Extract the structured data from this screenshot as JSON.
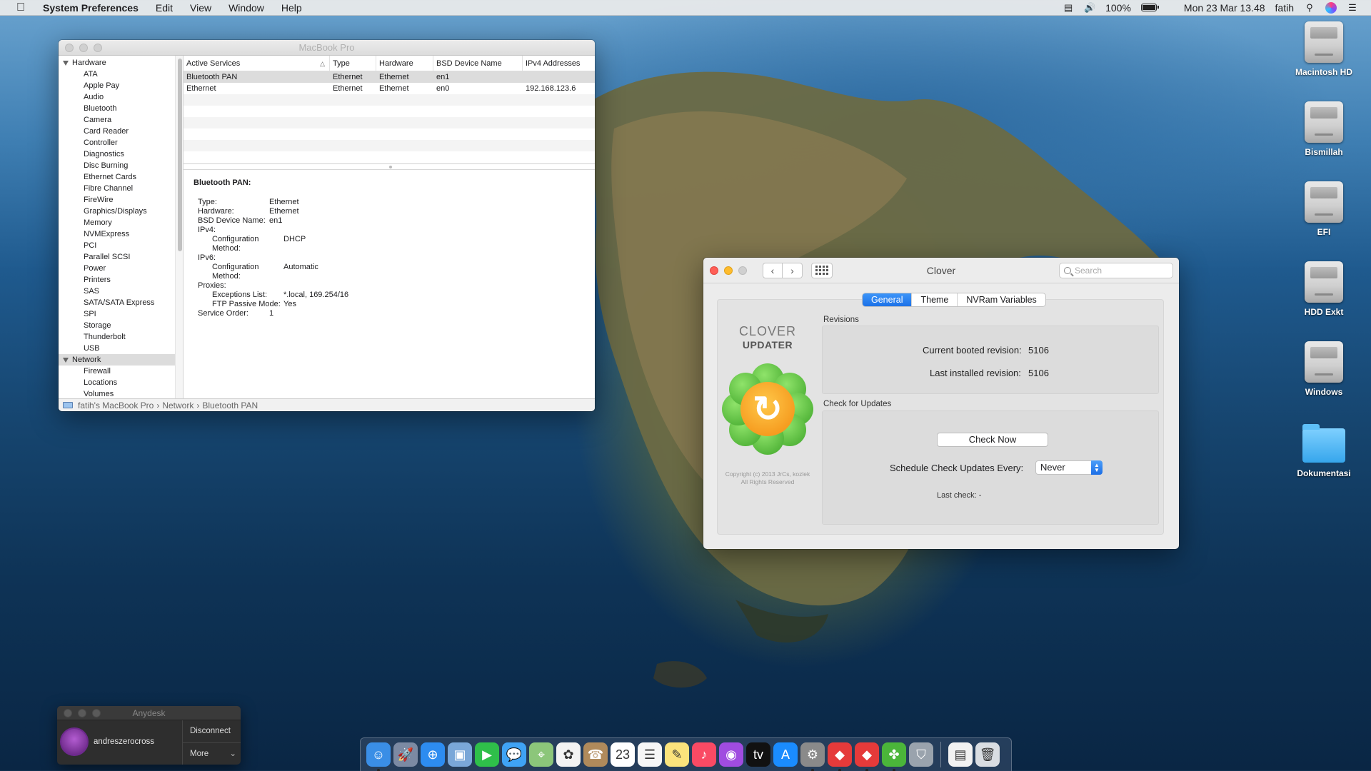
{
  "menubar": {
    "app_name": "System Preferences",
    "items": [
      "Edit",
      "View",
      "Window",
      "Help"
    ],
    "battery_percent": "100%",
    "datetime": "Mon 23 Mar  13.48",
    "user": "fatih"
  },
  "desktop_icons": [
    {
      "label": "Macintosh HD",
      "icon": "hdd"
    },
    {
      "label": "Bismillah",
      "icon": "hdd"
    },
    {
      "label": "EFI",
      "icon": "hdd"
    },
    {
      "label": "HDD Exkt",
      "icon": "hdd"
    },
    {
      "label": "Windows",
      "icon": "hdd"
    },
    {
      "label": "Dokumentasi",
      "icon": "folder"
    }
  ],
  "sysinfo": {
    "title": "MacBook Pro",
    "sidebar": {
      "hardware_label": "Hardware",
      "hardware_items": [
        "ATA",
        "Apple Pay",
        "Audio",
        "Bluetooth",
        "Camera",
        "Card Reader",
        "Controller",
        "Diagnostics",
        "Disc Burning",
        "Ethernet Cards",
        "Fibre Channel",
        "FireWire",
        "Graphics/Displays",
        "Memory",
        "NVMExpress",
        "PCI",
        "Parallel SCSI",
        "Power",
        "Printers",
        "SAS",
        "SATA/SATA Express",
        "SPI",
        "Storage",
        "Thunderbolt",
        "USB"
      ],
      "network_label": "Network",
      "network_items": [
        "Firewall",
        "Locations",
        "Volumes"
      ]
    },
    "table": {
      "headers": [
        "Active Services",
        "Type",
        "Hardware",
        "BSD Device Name",
        "IPv4 Addresses"
      ],
      "rows": [
        [
          "Bluetooth PAN",
          "Ethernet",
          "Ethernet",
          "en1",
          ""
        ],
        [
          "Ethernet",
          "Ethernet",
          "Ethernet",
          "en0",
          "192.168.123.6"
        ]
      ]
    },
    "details": {
      "heading": "Bluetooth PAN:",
      "lines": [
        {
          "k": "Type:",
          "v": "Ethernet",
          "sub": false
        },
        {
          "k": "Hardware:",
          "v": "Ethernet",
          "sub": false
        },
        {
          "k": "BSD Device Name:",
          "v": "en1",
          "sub": false
        },
        {
          "k": "IPv4:",
          "v": "",
          "sub": false
        },
        {
          "k": "Configuration Method:",
          "v": "DHCP",
          "sub": true
        },
        {
          "k": "IPv6:",
          "v": "",
          "sub": false
        },
        {
          "k": "Configuration Method:",
          "v": "Automatic",
          "sub": true
        },
        {
          "k": "Proxies:",
          "v": "",
          "sub": false
        },
        {
          "k": "Exceptions List:",
          "v": "*.local, 169.254/16",
          "sub": true
        },
        {
          "k": "FTP Passive Mode:",
          "v": "Yes",
          "sub": true
        },
        {
          "k": "Service Order:",
          "v": "1",
          "sub": false
        }
      ]
    },
    "path": [
      "fatih's MacBook Pro",
      "Network",
      "Bluetooth PAN"
    ]
  },
  "clover": {
    "title": "Clover",
    "search_placeholder": "Search",
    "tabs": [
      "General",
      "Theme",
      "NVRam Variables"
    ],
    "active_tab": "General",
    "logo_line1": "CLOVER",
    "logo_line2": "UPDATER",
    "copyright_line1": "Copyright (c) 2013 JrCs, kozlek",
    "copyright_line2": "All Rights Reserved",
    "revisions_label": "Revisions",
    "current_label": "Current booted revision:",
    "current_value": "5106",
    "installed_label": "Last installed revision:",
    "installed_value": "5106",
    "check_label": "Check for Updates",
    "check_now": "Check Now",
    "schedule_label": "Schedule Check Updates Every:",
    "schedule_value": "Never",
    "last_check": "Last check: -"
  },
  "anydesk": {
    "title": "Anydesk",
    "user": "andreszerocross",
    "disconnect": "Disconnect",
    "more": "More"
  },
  "dock": {
    "apps": [
      {
        "name": "finder-icon",
        "color": "#3a8ee6",
        "glyph": "☺"
      },
      {
        "name": "launchpad-icon",
        "color": "#7c8aa3",
        "glyph": "🚀"
      },
      {
        "name": "safari-icon",
        "color": "#2d8cf0",
        "glyph": "⊕"
      },
      {
        "name": "preview-icon",
        "color": "#7aa7d8",
        "glyph": "▣"
      },
      {
        "name": "facetime-icon",
        "color": "#2fbf4a",
        "glyph": "▶"
      },
      {
        "name": "messages-icon",
        "color": "#3fa3f5",
        "glyph": "💬"
      },
      {
        "name": "maps-icon",
        "color": "#8cc67a",
        "glyph": "⌖"
      },
      {
        "name": "photos-icon",
        "color": "#f3f3f3",
        "glyph": "✿"
      },
      {
        "name": "contacts-icon",
        "color": "#b08a5b",
        "glyph": "☎"
      },
      {
        "name": "calendar-icon",
        "color": "#ffffff",
        "glyph": "23"
      },
      {
        "name": "reminders-icon",
        "color": "#f6f6f6",
        "glyph": "☰"
      },
      {
        "name": "notes-icon",
        "color": "#fbe37c",
        "glyph": "✎"
      },
      {
        "name": "music-icon",
        "color": "#fa4a64",
        "glyph": "♪"
      },
      {
        "name": "podcasts-icon",
        "color": "#a04ce0",
        "glyph": "◉"
      },
      {
        "name": "tv-icon",
        "color": "#111111",
        "glyph": "tv"
      },
      {
        "name": "appstore-icon",
        "color": "#1a8cff",
        "glyph": "A"
      },
      {
        "name": "system-preferences-icon",
        "color": "#8a8a8a",
        "glyph": "⚙"
      },
      {
        "name": "anydesk-icon",
        "color": "#e53a3a",
        "glyph": "◆"
      },
      {
        "name": "anydesk-alt-icon",
        "color": "#e53a3a",
        "glyph": "◆"
      },
      {
        "name": "clover-icon",
        "color": "#4bb53a",
        "glyph": "✤"
      },
      {
        "name": "disk-utility-icon",
        "color": "#9aa3ad",
        "glyph": "⛉"
      }
    ],
    "docs": [
      {
        "name": "document-icon",
        "color": "#f2f2f2",
        "glyph": "▤"
      },
      {
        "name": "trash-icon",
        "color": "#d9dde2",
        "glyph": "🗑"
      }
    ]
  }
}
